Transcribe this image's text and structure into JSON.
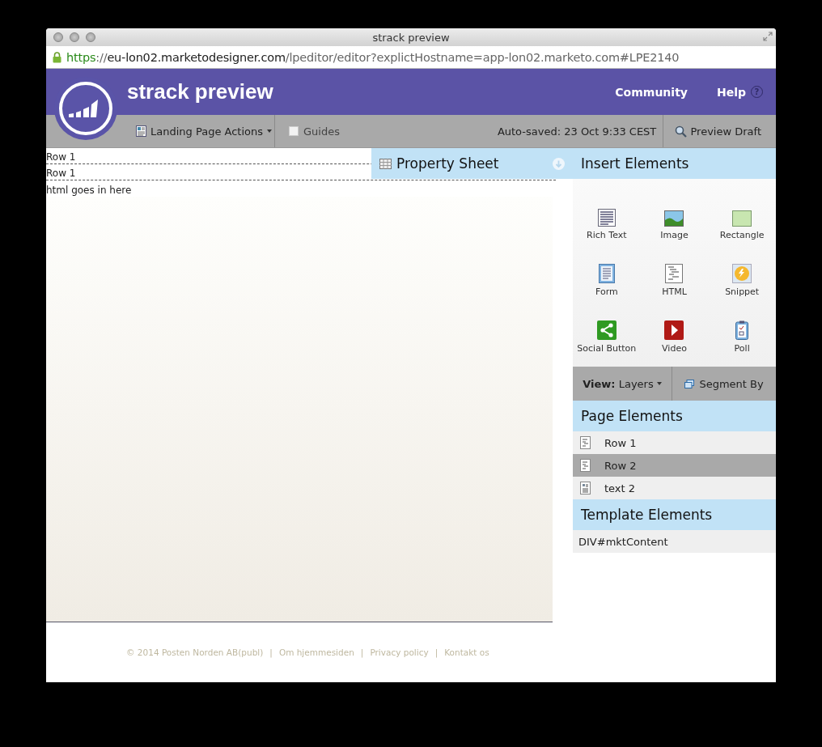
{
  "window": {
    "title": "strack preview"
  },
  "url": {
    "scheme": "https",
    "separator": "://",
    "host": "eu-lon02.marketodesigner.com",
    "path": "/lpeditor/editor?explictHostname=app-lon02.marketo.com#LPE2140"
  },
  "header": {
    "title": "strack preview",
    "links": [
      "Community",
      "Help"
    ],
    "help_glyph": "?"
  },
  "toolbar": {
    "actions": "Landing Page Actions",
    "guides": {
      "label": "Guides",
      "checked": false
    },
    "status": "Auto-saved: 23 Oct 9:33 CEST",
    "preview": "Preview Draft"
  },
  "canvas": {
    "rows": [
      "Row 1",
      "Row 1"
    ],
    "html": "html goes in here"
  },
  "property_sheet": {
    "title": "Property Sheet"
  },
  "insert_elements": {
    "title": "Insert Elements",
    "items": [
      {
        "label": "Rich Text",
        "kind": "richtext"
      },
      {
        "label": "Image",
        "kind": "image"
      },
      {
        "label": "Rectangle",
        "kind": "rectangle"
      },
      {
        "label": "Form",
        "kind": "form"
      },
      {
        "label": "HTML",
        "kind": "html"
      },
      {
        "label": "Snippet",
        "kind": "snippet"
      },
      {
        "label": "Social Button",
        "kind": "social"
      },
      {
        "label": "Video",
        "kind": "video"
      },
      {
        "label": "Poll",
        "kind": "poll"
      }
    ]
  },
  "view_bar": {
    "view_label": "View:",
    "view_value": "Layers",
    "segment": "Segment By"
  },
  "page_elements": {
    "title": "Page Elements",
    "items": [
      {
        "label": "Row 1",
        "kind": "row",
        "selected": false
      },
      {
        "label": "Row 2",
        "kind": "row",
        "selected": true
      },
      {
        "label": "text 2",
        "kind": "text",
        "selected": false
      }
    ]
  },
  "template_elements": {
    "title": "Template Elements",
    "items": [
      "DIV#mktContent"
    ]
  },
  "footer": {
    "separator": "|",
    "links": [
      "© 2014 Posten Norden AB(publ)",
      "Om hjemmesiden",
      "Privacy policy",
      "Kontakt os"
    ]
  }
}
